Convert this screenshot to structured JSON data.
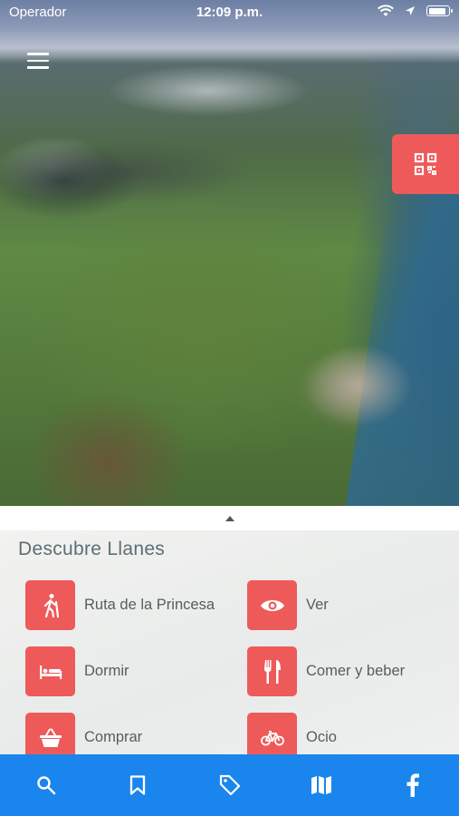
{
  "status_bar": {
    "carrier": "Operador",
    "time": "12:09 p.m.",
    "battery_level": 0.9
  },
  "header": {
    "menu_icon": "hamburger-menu-icon",
    "qr_icon": "qr-code-icon"
  },
  "panel": {
    "title": "Descubre Llanes",
    "items": [
      {
        "label": "Ruta de la Princesa",
        "icon": "hiker-icon"
      },
      {
        "label": "Ver",
        "icon": "eye-icon"
      },
      {
        "label": "Dormir",
        "icon": "bed-icon"
      },
      {
        "label": "Comer y beber",
        "icon": "fork-knife-icon"
      },
      {
        "label": "Comprar",
        "icon": "basket-icon"
      },
      {
        "label": "Ocio",
        "icon": "bicycle-icon"
      }
    ]
  },
  "tabbar": {
    "tabs": [
      {
        "icon": "search-icon"
      },
      {
        "icon": "bookmark-icon"
      },
      {
        "icon": "tag-icon"
      },
      {
        "icon": "map-icon"
      },
      {
        "icon": "facebook-icon"
      }
    ]
  },
  "colors": {
    "accent": "#ee5a5a",
    "tabbar": "#1a85ec",
    "title": "#5c6e74"
  }
}
